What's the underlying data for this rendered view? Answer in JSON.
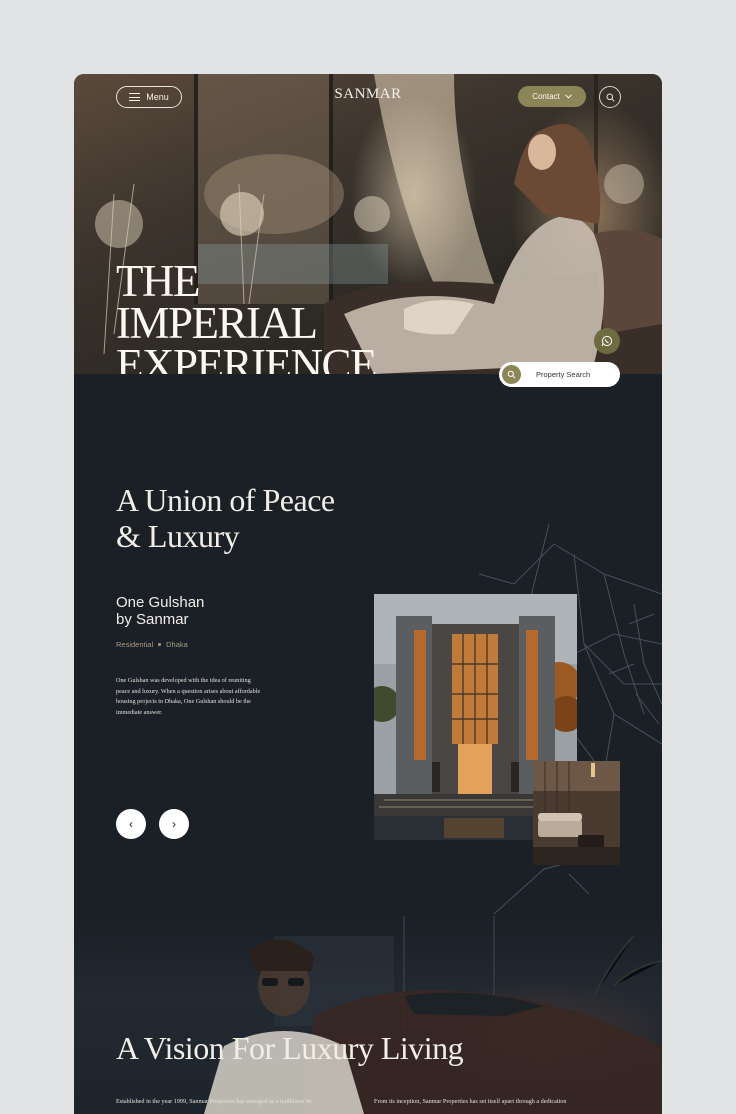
{
  "header": {
    "menu_label": "Menu",
    "brand_name": "SANMAR",
    "brand_tagline": "",
    "contact_label": "Contact"
  },
  "hero": {
    "title_lines": [
      "THE",
      "IMPERIAL",
      "EXPERIENCE"
    ],
    "property_search_label": "Property Search"
  },
  "intro": {
    "title_lines": [
      "A Union of Peace",
      "& Luxury"
    ],
    "project": {
      "name_lines": [
        "One Gulshan",
        "by Sanmar"
      ],
      "tags": [
        "Residential",
        "Dhaka"
      ],
      "description": "One Gulshan was developed with the idea of reuniting peace and luxury. When a question arises about affordable housing projects in Dhaka, One Gulshan should be the immediate answer."
    },
    "prev_label": "‹",
    "next_label": "›"
  },
  "vision": {
    "title": "A Vision For Luxury Living",
    "text_left": "Established in the year 1999, Sanmar Properties has emerged as a trailblazer in",
    "text_right": "From its inception, Sanmar Properties has set itself apart through a dedication"
  },
  "colors": {
    "background": "#1b1f26",
    "accent_olive": "#8b8558",
    "text_light": "#f1ede7",
    "tag_muted": "#a89b85"
  },
  "icons": [
    "menu-icon",
    "chevron-down-icon",
    "search-icon",
    "whatsapp-icon",
    "search-icon",
    "arrow-left-icon",
    "arrow-right-icon"
  ]
}
